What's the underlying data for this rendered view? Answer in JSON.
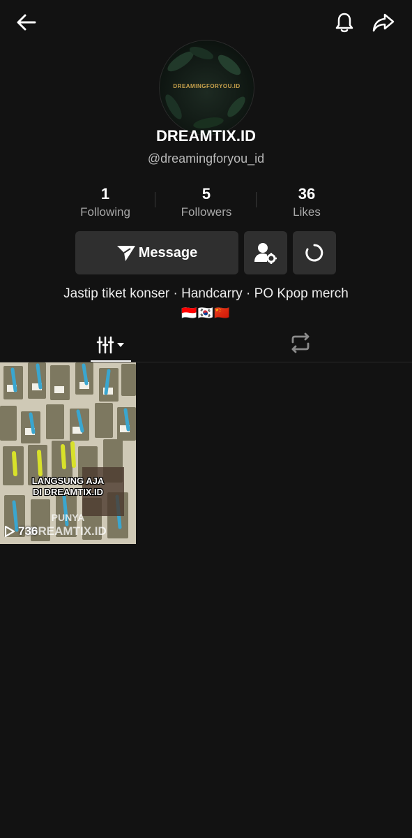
{
  "header": {
    "back_icon": "arrow-left-icon",
    "notification_icon": "bell-icon",
    "share_icon": "share-arrow-icon"
  },
  "profile": {
    "avatar_text": "DREAMINGFORYOU.ID",
    "display_name": "DREAMTIX.ID",
    "username": "@dreamingforyou_id"
  },
  "stats": [
    {
      "value": "1",
      "label": "Following"
    },
    {
      "value": "5",
      "label": "Followers"
    },
    {
      "value": "36",
      "label": "Likes"
    }
  ],
  "actions": {
    "message_label": "Message",
    "message_icon": "send-icon",
    "user_settings_icon": "user-gear-icon",
    "refresh_icon": "refresh-icon"
  },
  "bio": {
    "text": "Jastip tiket konser · Handcarry · PO Kpop merch",
    "flags": "🇮🇩🇰🇷🇨🇳"
  },
  "tabs": {
    "videos_icon": "grid-columns-icon",
    "reposts_icon": "repost-icon"
  },
  "videos": [
    {
      "caption_line1": "LANGSUNG AJA",
      "caption_line2": "DI DREAMTIX.ID",
      "watermark_line1": "PUNYA",
      "watermark_line2": "DREAMTIX.ID",
      "views": "736"
    }
  ],
  "colors": {
    "background": "#121212",
    "button_bg": "#2f2f2f",
    "muted_text": "#a8a8a8"
  }
}
